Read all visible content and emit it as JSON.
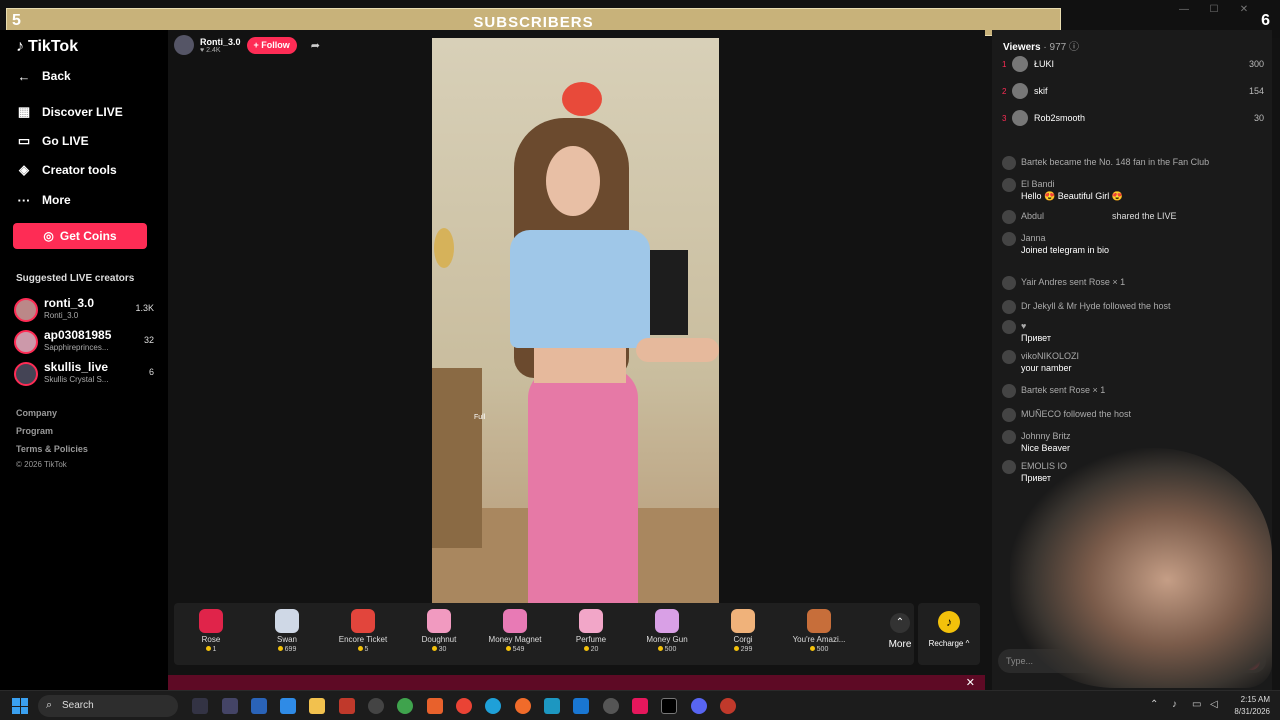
{
  "overlay": {
    "banner": "SUBSCRIBERS",
    "left_number": "5",
    "right_number": "6"
  },
  "sidebar": {
    "logo": "TikTok",
    "nav": [
      {
        "label": "Back"
      },
      {
        "label": "Discover LIVE"
      },
      {
        "label": "Go LIVE"
      },
      {
        "label": "Creator tools"
      },
      {
        "label": "More"
      }
    ],
    "get_coins": "Get Coins",
    "suggested_title": "Suggested LIVE creators",
    "creators": [
      {
        "name": "ronti_3.0",
        "sub": "Ronti_3.0",
        "count": "1.3K"
      },
      {
        "name": "ap03081985",
        "sub": "Sapphireprinces...",
        "count": "32"
      },
      {
        "name": "skullis_live",
        "sub": "Skullis Crystal S...",
        "count": "6"
      }
    ],
    "footer": [
      "Company",
      "Program",
      "Terms & Policies",
      "© 2026 TikTok"
    ]
  },
  "stream": {
    "host_name": "Ronti_3.0",
    "host_likes": "♥ 2.4K",
    "follow": "+ Follow",
    "filter_label": "Full"
  },
  "gifts": [
    {
      "name": "Rose",
      "price": "1",
      "color": "#e0244a"
    },
    {
      "name": "Swan",
      "price": "699",
      "color": "#cfd8e6"
    },
    {
      "name": "Encore Ticket",
      "price": "5",
      "color": "#e2453c"
    },
    {
      "name": "Doughnut",
      "price": "30",
      "color": "#f19ac0"
    },
    {
      "name": "Money Magnet",
      "price": "549",
      "color": "#e87ab5"
    },
    {
      "name": "Perfume",
      "price": "20",
      "color": "#f2a6c8"
    },
    {
      "name": "Money Gun",
      "price": "500",
      "color": "#d9a0e6"
    },
    {
      "name": "Corgi",
      "price": "299",
      "color": "#f0b27a"
    },
    {
      "name": "You're Amazi...",
      "price": "500",
      "color": "#c76e3a"
    }
  ],
  "more_label": "More",
  "recharge_label": "Recharge ^",
  "panel": {
    "viewers_label": "Viewers",
    "viewers_count": " · 977",
    "ranking": [
      {
        "rank": "1",
        "name": "ŁUKI",
        "score": "300"
      },
      {
        "rank": "2",
        "name": "skif",
        "score": "154"
      },
      {
        "rank": "3",
        "name": "Rob2smooth",
        "score": "30"
      }
    ],
    "chat": [
      {
        "user": "Bartek became the No. 148 fan in the Fan Club",
        "msg": ""
      },
      {
        "user": "El Bandi",
        "msg": "Hello 😍 Beautiful Girl 😍"
      },
      {
        "user": "Abdul",
        "msg": "",
        "action": "shared the LIVE"
      },
      {
        "user": "Janna",
        "msg": "Joined telegram in bio"
      },
      {
        "user": "Yair Andres sent Rose × 1",
        "msg": ""
      },
      {
        "user": "Dr Jekyll & Mr Hyde followed the host",
        "msg": ""
      },
      {
        "user": "♥",
        "msg": "Привет"
      },
      {
        "user": "vikoNIKOLOZI",
        "msg": "your namber"
      },
      {
        "user": "Bartek sent Rose × 1",
        "msg": ""
      },
      {
        "user": "MUÑECO followed the host",
        "msg": ""
      },
      {
        "user": "Johnny Britz",
        "msg": "Nice Beaver"
      },
      {
        "user": "EMOLIS IO",
        "msg": "Привет"
      }
    ],
    "type_placeholder": "Type..."
  },
  "taskbar": {
    "search": "Search",
    "time": "2:15 AM",
    "date": "8/31/2026"
  }
}
